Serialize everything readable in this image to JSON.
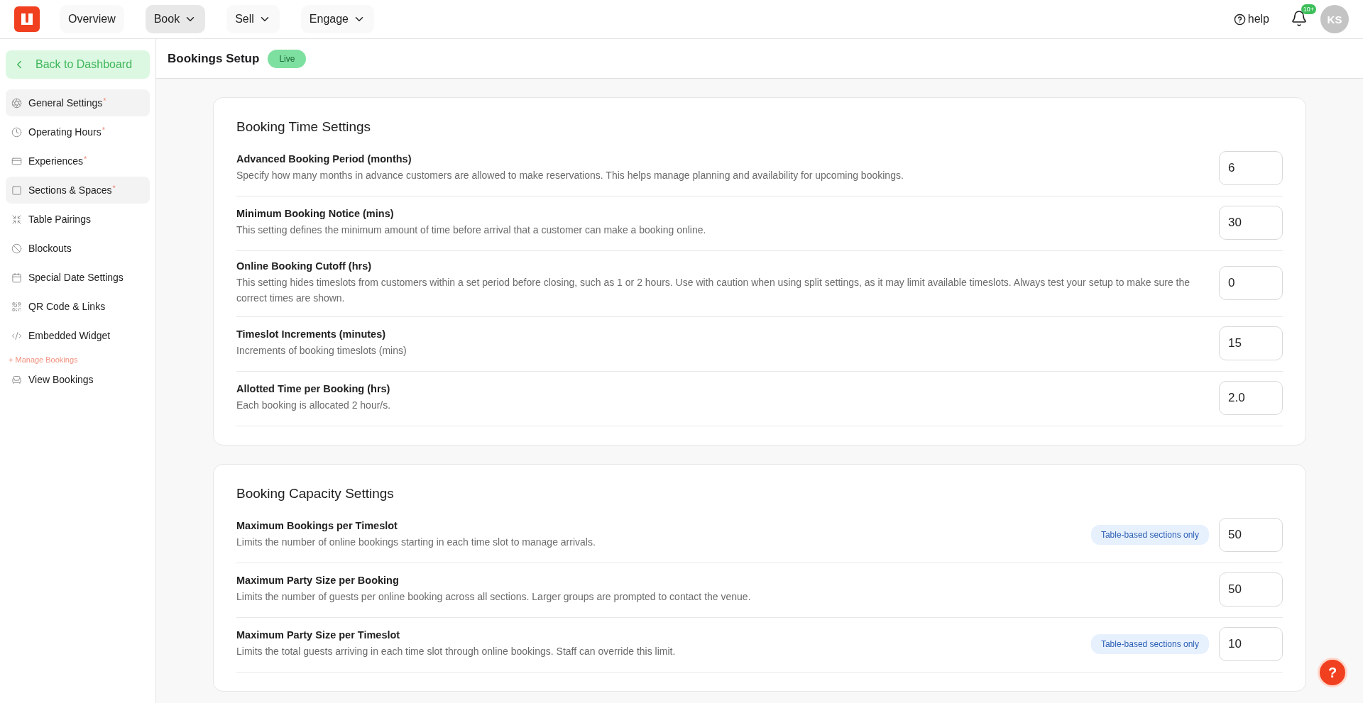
{
  "nav": {
    "items": [
      {
        "label": "Overview",
        "dropdown": false,
        "selected": false
      },
      {
        "label": "Book",
        "dropdown": true,
        "selected": true
      },
      {
        "label": "Sell",
        "dropdown": true,
        "selected": false
      },
      {
        "label": "Engage",
        "dropdown": true,
        "selected": false
      }
    ],
    "help": "help",
    "notification_badge": "10+",
    "avatar": "KS"
  },
  "sidebar": {
    "back": "Back to Dashboard",
    "items": [
      {
        "kind": "item",
        "label": "General Settings",
        "required_mark": "*",
        "selected": true
      },
      {
        "kind": "item",
        "label": "Operating Hours",
        "required_mark": "*",
        "selected": false
      },
      {
        "kind": "item",
        "label": "Experiences",
        "required_mark": "*",
        "selected": false
      },
      {
        "kind": "item",
        "label": "Sections & Spaces",
        "required_mark": "*",
        "selected": true
      },
      {
        "kind": "item",
        "label": "Table Pairings",
        "selected": false
      },
      {
        "kind": "item",
        "label": "Blockouts",
        "selected": false
      },
      {
        "kind": "item",
        "label": "Special Date Settings",
        "selected": false
      },
      {
        "kind": "item",
        "label": "QR Code & Links",
        "selected": false
      },
      {
        "kind": "item",
        "label": "Embedded Widget",
        "selected": false
      },
      {
        "kind": "heading",
        "label": "+ Manage Bookings"
      },
      {
        "kind": "item",
        "label": "View Bookings",
        "selected": false
      }
    ]
  },
  "header": {
    "title": "Bookings Setup",
    "status": "Live"
  },
  "cards": [
    {
      "title": "Booking Time Settings",
      "rows": [
        {
          "title": "Advanced Booking Period (months)",
          "description": "Specify how many months in advance customers are allowed to make reservations. This helps manage planning and availability for upcoming bookings.",
          "value": "6"
        },
        {
          "title": "Minimum Booking Notice (mins)",
          "description": "This setting defines the minimum amount of time before arrival that a customer can make a booking online.",
          "value": "30"
        },
        {
          "title": "Online Booking Cutoff (hrs)",
          "description": "This setting hides timeslots from customers within a set period before closing, such as 1 or 2 hours. Use with caution when using split settings, as it may limit available timeslots. Always test your setup to make sure the correct times are shown.",
          "value": "0"
        },
        {
          "title": "Timeslot Increments (minutes)",
          "description": "Increments of booking timeslots (mins)",
          "value": "15"
        },
        {
          "title": "Allotted Time per Booking (hrs)",
          "description": "Each booking is allocated 2 hour/s.",
          "value": "2.0"
        }
      ]
    },
    {
      "title": "Booking Capacity Settings",
      "rows": [
        {
          "title": "Maximum Bookings per Timeslot",
          "description": "Limits the number of online bookings starting in each time slot to manage arrivals.",
          "value": "50",
          "tag": "Table-based sections only"
        },
        {
          "title": "Maximum Party Size per Booking",
          "description": "Limits the number of guests per online booking across all sections. Larger groups are prompted to contact the venue.",
          "value": "50"
        },
        {
          "title": "Maximum Party Size per Timeslot",
          "description": "Limits the total guests arriving in each time slot through online bookings. Staff can override this limit.",
          "value": "10",
          "tag": "Table-based sections only"
        }
      ]
    }
  ],
  "help_button": "?"
}
